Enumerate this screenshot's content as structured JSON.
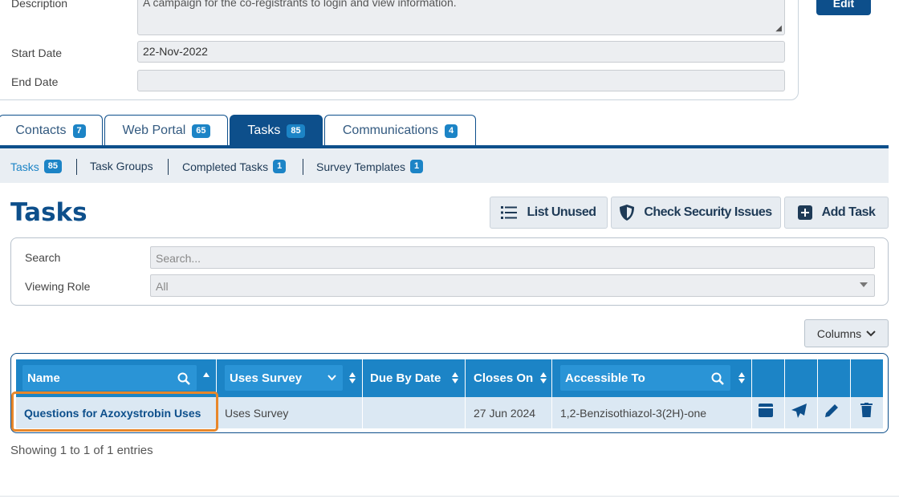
{
  "campaign": {
    "description_label": "Description",
    "description_value": "A campaign for the co-registrants to login and view information.",
    "start_date_label": "Start Date",
    "start_date_value": "22-Nov-2022",
    "end_date_label": "End Date",
    "end_date_value": "",
    "edit_label": "Edit"
  },
  "main_tabs": [
    {
      "label": "Contacts",
      "count": "7"
    },
    {
      "label": "Web Portal",
      "count": "65"
    },
    {
      "label": "Tasks",
      "count": "85",
      "active": true
    },
    {
      "label": "Communications",
      "count": "4"
    }
  ],
  "sub_tabs": [
    {
      "label": "Tasks",
      "count": "85",
      "active": true
    },
    {
      "label": "Task Groups",
      "count": ""
    },
    {
      "label": "Completed Tasks",
      "count": "1"
    },
    {
      "label": "Survey Templates",
      "count": "1"
    }
  ],
  "page_title": "Tasks",
  "toolbar": {
    "list_unused": "List Unused",
    "check_security": "Check Security Issues",
    "add_task": "Add Task"
  },
  "filters": {
    "search_label": "Search",
    "search_placeholder": "Search...",
    "role_label": "Viewing Role",
    "role_value": "All"
  },
  "columns_button": "Columns",
  "table": {
    "headers": [
      "Name",
      "Uses Survey",
      "Due By Date",
      "Closes On",
      "Accessible To"
    ],
    "rows": [
      {
        "name": "Questions for Azoxystrobin Uses",
        "uses_survey": "Uses Survey",
        "due_by": "",
        "closes_on": "27 Jun 2024",
        "accessible_to": "1,2-Benzisothiazol-3(2H)-one"
      }
    ]
  },
  "showing_text": "Showing 1 to 1 of 1 entries",
  "colors": {
    "primary": "#0d4f8b",
    "accent": "#1c84c6",
    "highlight": "#e8872a"
  }
}
